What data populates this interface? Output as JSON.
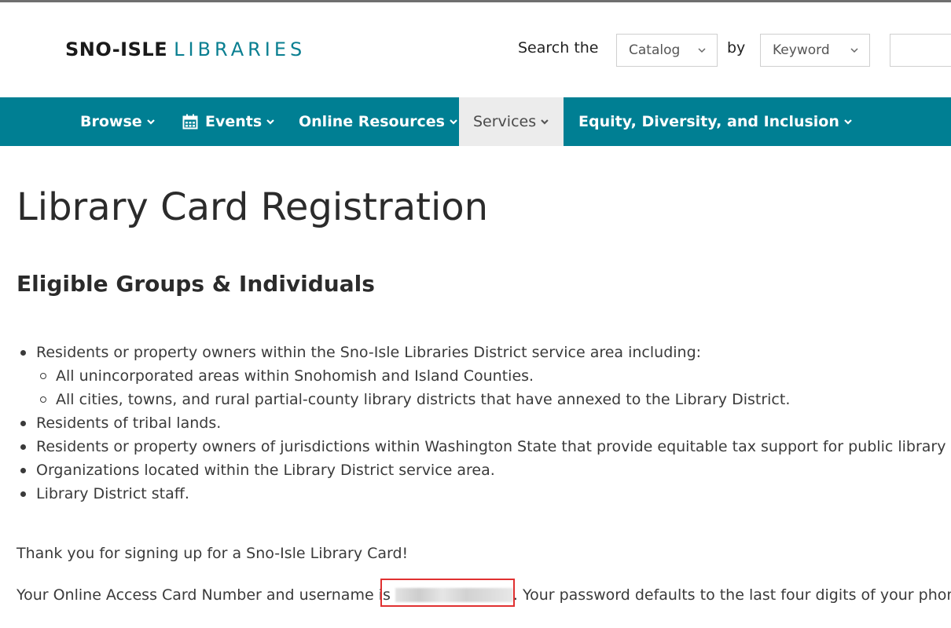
{
  "header": {
    "logo_bold": "SNO-ISLE",
    "logo_light": "LIBRARIES",
    "search_label": "Search the",
    "catalog_select": "Catalog",
    "by_label": "by",
    "keyword_select": "Keyword"
  },
  "nav": {
    "items": [
      {
        "label": "Browse"
      },
      {
        "label": "Events"
      },
      {
        "label": "Online Resources"
      },
      {
        "label": "Services"
      },
      {
        "label": "Equity, Diversity, and Inclusion"
      }
    ],
    "active": "Services"
  },
  "main": {
    "title": "Library Card Registration",
    "section_title": "Eligible Groups & Individuals",
    "list": [
      "Residents or property owners within the Sno-Isle Libraries District service area including:",
      "All unincorporated areas within Snohomish and Island Counties.",
      "All cities, towns, and rural partial-county library districts that have annexed to the Library District.",
      "Residents of tribal lands.",
      "Residents or property owners of jurisdictions within Washington State that provide equitable tax support for public library ser",
      "Organizations located within the Library District service area.",
      "Library District staff."
    ],
    "thanks": "Thank you for signing up for a Sno-Isle Library Card!",
    "card_prefix": "Your Online Access Card Number and username is",
    "card_suffix": ". Your password defaults to the last four digits of your phone"
  },
  "colors": {
    "nav_bg": "#007f93",
    "logo_accent": "#0a7f91",
    "highlight": "#e03030"
  }
}
